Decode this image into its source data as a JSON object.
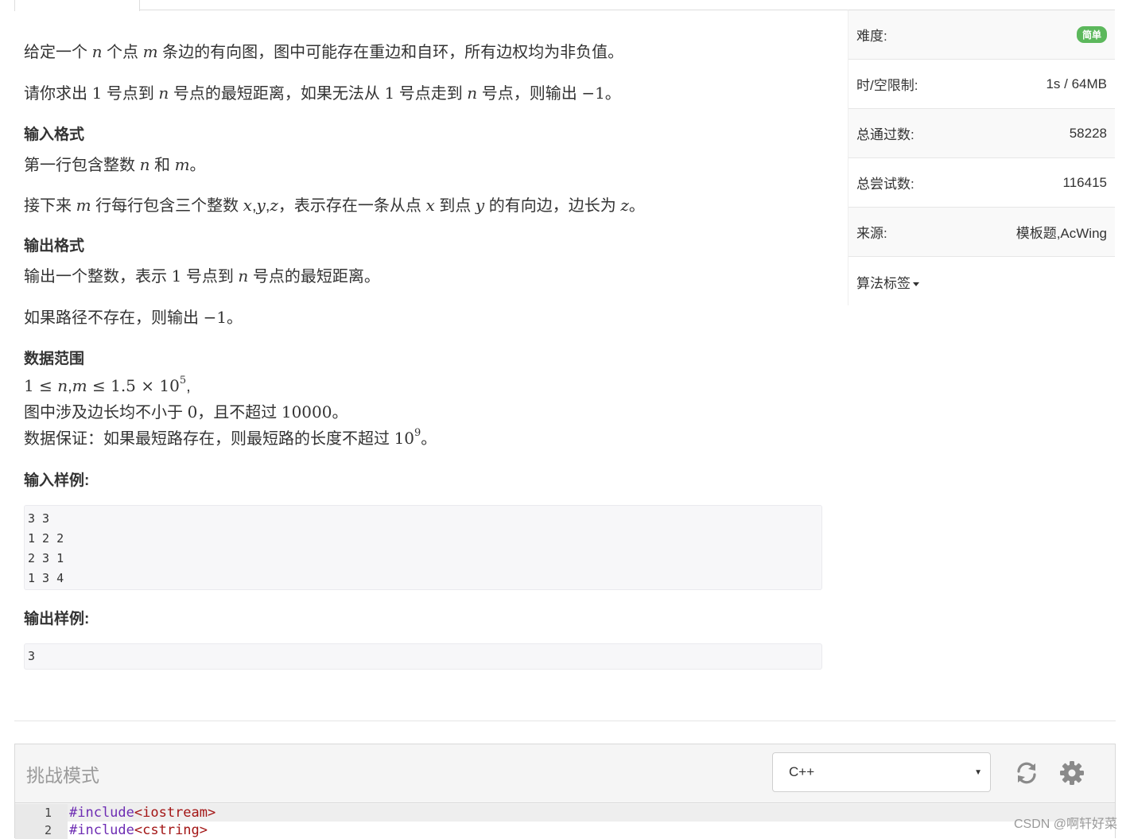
{
  "problem": {
    "desc_1": "给定一个 n 个点 m 条边的有向图，图中可能存在重边和自环，所有边权均为非负值。",
    "desc_2": "请你求出 1 号点到 n 号点的最短距离，如果无法从 1 号点走到 n 号点，则输出 −1。",
    "input_heading": "输入格式",
    "input_1": "第一行包含整数 n 和 m。",
    "input_2": "接下来 m 行每行包含三个整数 x,y,z，表示存在一条从点 x 到点 y 的有向边，边长为 z。",
    "output_heading": "输出格式",
    "output_1": "输出一个整数，表示 1 号点到 n 号点的最短距离。",
    "output_2": "如果路径不存在，则输出 −1。",
    "range_heading": "数据范围",
    "range_1": "1 ≤ n,m ≤ 1.5 × 10^5,",
    "range_2": "图中涉及边长均不小于 0，且不超过 10000。",
    "range_3": "数据保证：如果最短路存在，则最短路的长度不超过 10^9。",
    "sample_in_heading": "输入样例:",
    "sample_in": "3 3\n1 2 2\n2 3 1\n1 3 4",
    "sample_out_heading": "输出样例:",
    "sample_out": "3"
  },
  "sidebar": {
    "difficulty_label": "难度:",
    "difficulty_badge": "简单",
    "limit_label": "时/空限制:",
    "limit_value": "1s / 64MB",
    "passed_label": "总通过数:",
    "passed_value": "58228",
    "attempts_label": "总尝试数:",
    "attempts_value": "116415",
    "source_label": "来源:",
    "source_value": "模板题,AcWing",
    "tags_label": "算法标签"
  },
  "editor": {
    "mode_title": "挑战模式",
    "language": "C++",
    "refresh_icon": "refresh-icon",
    "settings_icon": "gear-icon",
    "lines": [
      {
        "num": "1",
        "directive": "#include",
        "header": "<iostream>"
      },
      {
        "num": "2",
        "directive": "#include",
        "header": "<cstring>"
      }
    ]
  },
  "watermark": "CSDN @啊轩好菜",
  "colors": {
    "badge": "#5cb85c",
    "directive": "#6d2cb3",
    "header": "#a31515"
  }
}
